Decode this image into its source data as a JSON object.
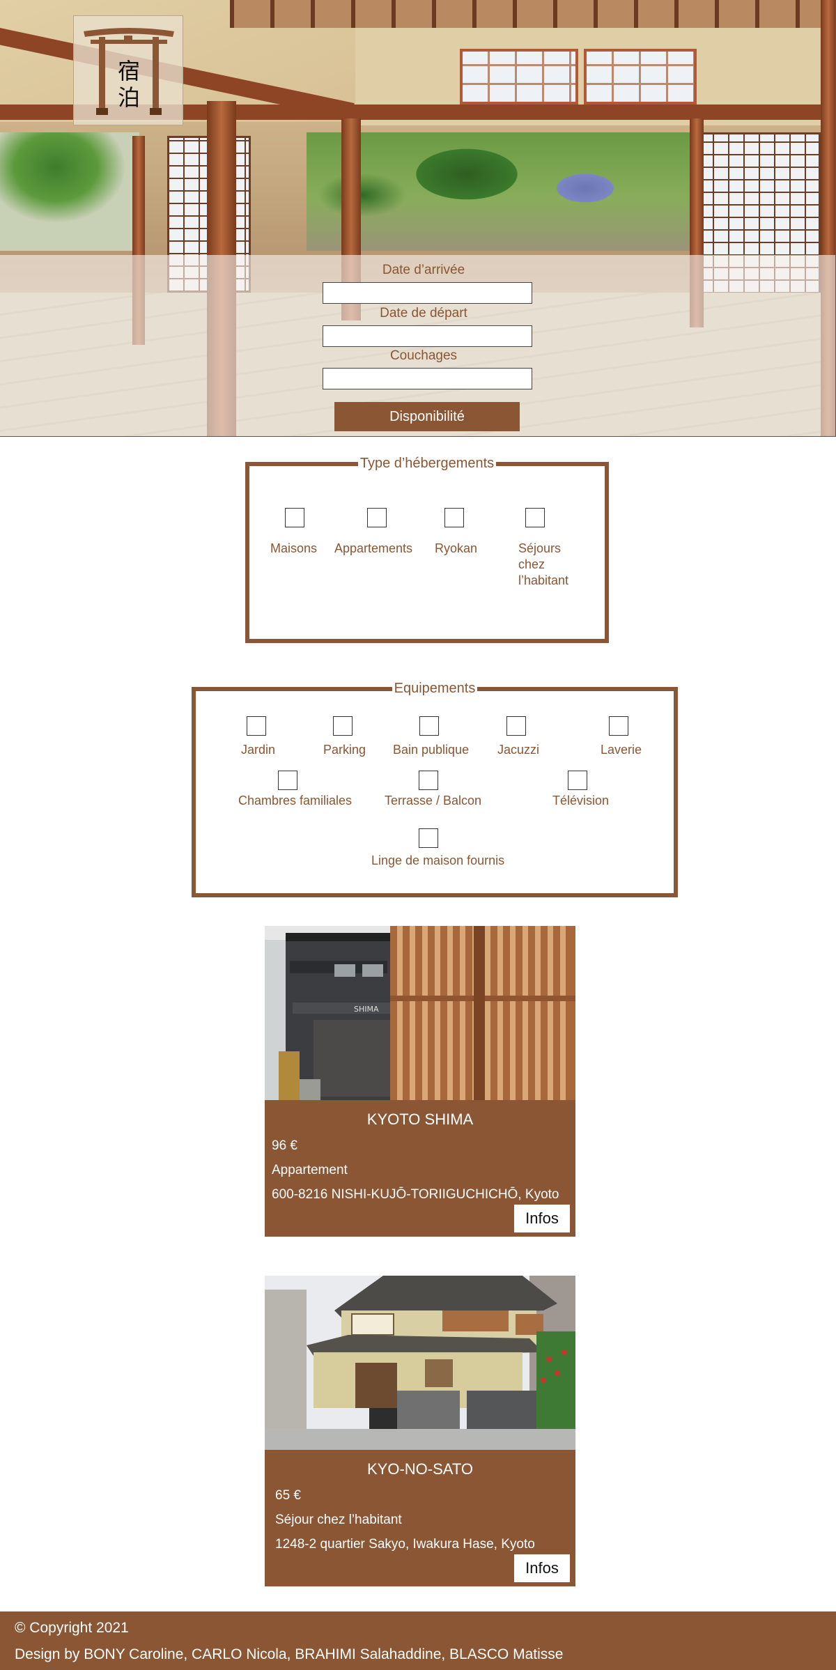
{
  "logo": {
    "kanji_top": "宿",
    "kanji_bottom": "泊"
  },
  "search": {
    "arrival_label": "Date d’arrivée",
    "departure_label": "Date de départ",
    "beds_label": "Couchages",
    "arrival_value": "",
    "departure_value": "",
    "beds_value": "",
    "submit_label": "Disponibilité"
  },
  "accommodation_types": {
    "title": "Type d’hébergements",
    "items": [
      "Maisons",
      "Appartements",
      "Ryokan",
      "Séjours chez l’habitant"
    ]
  },
  "equipment": {
    "title": "Equipements",
    "items": [
      "Jardin",
      "Parking",
      "Bain publique",
      "Jacuzzi",
      "Laverie",
      "Chambres familiales",
      "Terrasse / Balcon",
      "Télévision",
      "Linge de maison fournis"
    ]
  },
  "listings": [
    {
      "name": "KYOTO SHIMA",
      "price": "96 €",
      "type": "Appartement",
      "address": "600-8216 NISHI-KUJŌ-TORIIGUCHICHŌ, Kyoto",
      "button_label": "Infos",
      "sign_text": "SHIMA"
    },
    {
      "name": "KYO-NO-SATO",
      "price": "65 €",
      "type": "Séjour chez l’habitant",
      "address": "1248-2 quartier Sakyo, Iwakura Hase, Kyoto",
      "button_label": "Infos"
    }
  ],
  "footer": {
    "copyright": "© Copyright 2021",
    "credits": "Design by BONY Caroline, CARLO Nicola, BRAHIMI Salahaddine, BLASCO Matisse"
  },
  "colors": {
    "brand": "#8a5633",
    "white": "#ffffff"
  }
}
